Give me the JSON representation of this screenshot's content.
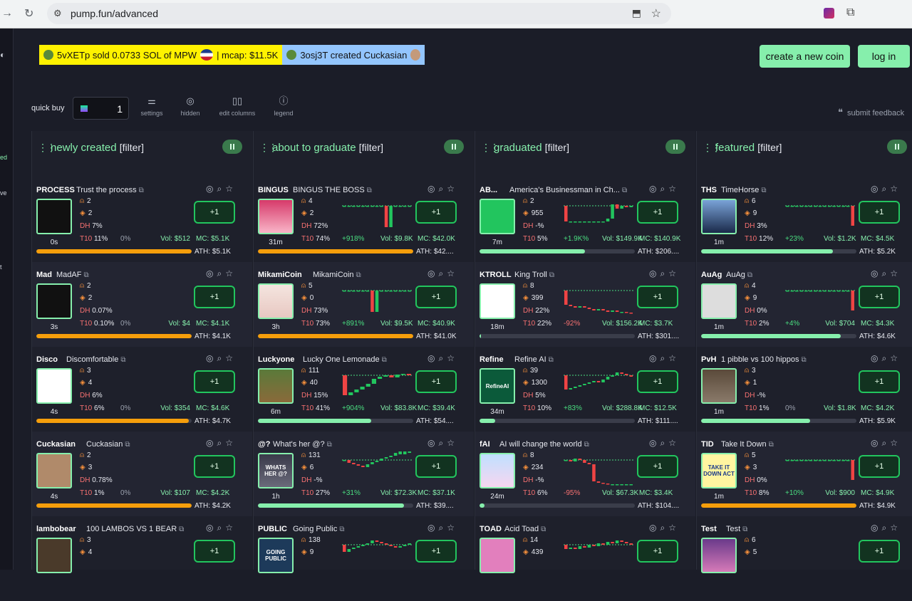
{
  "browser": {
    "url": "pump.fun/advanced"
  },
  "sidebar": {
    "items": [
      "ed",
      "ve",
      "t"
    ]
  },
  "ticker": {
    "item1": "5vXETp sold 0.0733 SOL of MPW",
    "item1_mcap": "| mcap: $11.5K",
    "item2": "3osj3T created Cuckasian"
  },
  "header": {
    "create_label": "create a new coin",
    "login_label": "log in"
  },
  "toolbar": {
    "quick_buy_label": "quick buy",
    "quick_buy_value": "1",
    "settings": "settings",
    "hidden": "hidden",
    "edit_columns": "edit columns",
    "legend": "legend",
    "feedback": "submit feedback"
  },
  "colors": {
    "accent": "#86efac",
    "bar_orange": "#f59e0b",
    "bar_green": "#86efac",
    "up": "#4ade80",
    "down": "#f87171"
  },
  "columns": [
    {
      "title": "newly created",
      "filter": "[filter]",
      "cards": [
        {
          "sym": "PROCESS",
          "name": "Trust the process",
          "holders": "2",
          "txs": "2",
          "dh": "7%",
          "t10": "11%",
          "chg": "0%",
          "vol": "$512",
          "mc": "$5.1K",
          "ath": "ATH: $5.1K",
          "age": "0s",
          "bar": 1.0,
          "color": "orange",
          "pic": "black",
          "spark": null
        },
        {
          "sym": "Mad",
          "name": "MadAF",
          "holders": "2",
          "txs": "2",
          "dh": "0.07%",
          "t10": "0.10%",
          "chg": "0%",
          "vol": "$4",
          "mc": "$4.1K",
          "ath": "ATH: $4.1K",
          "age": "3s",
          "bar": 1.0,
          "color": "orange",
          "pic": "black",
          "spark": null
        },
        {
          "sym": "Disco",
          "name": "Discomfortable",
          "holders": "3",
          "txs": "4",
          "dh": "6%",
          "t10": "6%",
          "chg": "0%",
          "vol": "$354",
          "mc": "$4.6K",
          "ath": "ATH: $4.7K",
          "age": "4s",
          "bar": 0.98,
          "color": "orange",
          "pic": "disco",
          "spark": null
        },
        {
          "sym": "Cuckasian",
          "name": "Cuckasian",
          "holders": "2",
          "txs": "3",
          "dh": "0.78%",
          "t10": "1%",
          "chg": "0%",
          "vol": "$107",
          "mc": "$4.2K",
          "ath": "ATH: $4.2K",
          "age": "4s",
          "bar": 1.0,
          "color": "orange",
          "pic": "face",
          "spark": null
        },
        {
          "sym": "lambobear",
          "name": "100 LAMBOS VS 1 BEAR",
          "holders": "3",
          "txs": "4",
          "dh": "",
          "t10": "",
          "chg": "",
          "vol": "",
          "mc": "",
          "ath": "",
          "age": "",
          "bar": 0,
          "color": "orange",
          "pic": "lambo",
          "spark": null
        }
      ]
    },
    {
      "title": "about to graduate",
      "filter": "[filter]",
      "cards": [
        {
          "sym": "BINGUS",
          "name": "BINGUS THE BOSS",
          "holders": "4",
          "txs": "2",
          "dh": "72%",
          "t10": "74%",
          "chg": "+918%",
          "vol": "$9.8K",
          "mc": "$42.0K",
          "ath": "ATH: $42....",
          "age": "31m",
          "bar": 1.0,
          "color": "orange",
          "pic": "pink",
          "spark": [
            0,
            0,
            0,
            0,
            0,
            0,
            0,
            0,
            0,
            -30,
            0,
            0,
            0,
            0,
            0
          ]
        },
        {
          "sym": "MikamiCoin",
          "name": "MikamiCoin",
          "holders": "5",
          "txs": "0",
          "dh": "73%",
          "t10": "73%",
          "chg": "+891%",
          "vol": "$9.5K",
          "mc": "$40.9K",
          "ath": "ATH: $41.0K",
          "age": "3h",
          "bar": 1.0,
          "color": "orange",
          "pic": "girl",
          "spark": [
            0,
            0,
            0,
            0,
            0,
            0,
            -30,
            0,
            0,
            0,
            0,
            0,
            0,
            0,
            0
          ]
        },
        {
          "sym": "Luckyone",
          "name": "Lucky One Lemonade",
          "holders": "111",
          "txs": "40",
          "dh": "15%",
          "t10": "41%",
          "chg": "+904%",
          "vol": "$83.8K",
          "mc": "$39.4K",
          "ath": "ATH: $54....",
          "age": "6m",
          "bar": 0.73,
          "color": "green",
          "pic": "dog",
          "spark": [
            -28,
            -24,
            -20,
            -16,
            -12,
            -5,
            -2,
            0,
            -3,
            1,
            2,
            0
          ]
        },
        {
          "sym": "@?",
          "name": "What's her @?",
          "holders": "131",
          "txs": "6",
          "dh": "-%",
          "t10": "27%",
          "chg": "+31%",
          "vol": "$72.3K",
          "mc": "$37.1K",
          "ath": "ATH: $39....",
          "age": "1h",
          "bar": 0.94,
          "color": "green",
          "pic": "whats",
          "spark": [
            0,
            -4,
            -6,
            -8,
            -10,
            -6,
            -3,
            -1,
            2,
            4,
            6,
            10,
            14,
            18,
            20
          ]
        },
        {
          "sym": "PUBLIC",
          "name": "Going Public",
          "holders": "138",
          "txs": "9",
          "dh": "",
          "t10": "",
          "chg": "",
          "vol": "",
          "mc": "",
          "ath": "",
          "age": "",
          "bar": 0,
          "color": "green",
          "pic": "public",
          "spark": [
            -10,
            -6,
            -4,
            -2,
            0,
            2,
            6,
            4,
            2,
            0,
            -2,
            -4,
            -2,
            0,
            2
          ]
        }
      ]
    },
    {
      "title": "graduated",
      "filter": "[filter]",
      "cards": [
        {
          "sym": "AB...",
          "name": "America's Businessman in Ch...",
          "holders": "2",
          "txs": "955",
          "dh": "-%",
          "t10": "5%",
          "chg": "+1.9K%",
          "vol": "$149.9K",
          "mc": "$140.9K",
          "ath": "ATH: $206....",
          "age": "7m",
          "bar": 0.68,
          "color": "green",
          "pic": "whale",
          "spark": [
            -22,
            -22,
            -22,
            -22,
            -22,
            -22,
            -22,
            -22,
            -22,
            -18,
            2,
            -4,
            0,
            -2,
            0
          ]
        },
        {
          "sym": "KTROLL",
          "name": "King Troll",
          "holders": "8",
          "txs": "399",
          "dh": "22%",
          "t10": "22%",
          "chg": "-92%",
          "vol": "$156.2K",
          "mc": "$3.7K",
          "ath": "ATH: $301....",
          "age": "18m",
          "bar": 0.01,
          "color": "green",
          "pic": "troll",
          "spark": [
            -20,
            -22,
            -24,
            -22,
            -24,
            -26,
            -28,
            -26,
            -28,
            -30,
            -28,
            -30,
            -30,
            -31,
            -32
          ]
        },
        {
          "sym": "Refine",
          "name": "Refine AI",
          "holders": "39",
          "txs": "1300",
          "dh": "5%",
          "t10": "10%",
          "chg": "+83%",
          "vol": "$288.8K",
          "mc": "$12.5K",
          "ath": "ATH: $111....",
          "age": "34m",
          "bar": 0.1,
          "color": "green",
          "pic": "refine",
          "spark": [
            -20,
            -18,
            -16,
            -14,
            -12,
            -10,
            -8,
            -10,
            -6,
            -2,
            0,
            4,
            2,
            0,
            -2
          ]
        },
        {
          "sym": "fAI",
          "name": "AI will change the world",
          "holders": "8",
          "txs": "234",
          "dh": "-%",
          "t10": "6%",
          "chg": "-95%",
          "vol": "$67.3K",
          "mc": "$3.4K",
          "ath": "ATH: $104....",
          "age": "24m",
          "bar": 0.03,
          "color": "green",
          "pic": "ai",
          "spark": [
            0,
            -2,
            2,
            0,
            -4,
            -6,
            -30,
            -32,
            -33,
            -34,
            -34,
            -34,
            -34,
            -34,
            -34
          ]
        },
        {
          "sym": "TOAD",
          "name": "Acid Toad",
          "holders": "14",
          "txs": "439",
          "dh": "",
          "t10": "",
          "chg": "",
          "vol": "",
          "mc": "",
          "ath": "",
          "age": "",
          "bar": 0,
          "color": "green",
          "pic": "toad",
          "spark": [
            -6,
            -4,
            -6,
            -2,
            -4,
            0,
            -2,
            2,
            0,
            4,
            2,
            6,
            4,
            2,
            0
          ]
        }
      ]
    },
    {
      "title": "featured",
      "filter": "[filter]",
      "cards": [
        {
          "sym": "THS",
          "name": "TimeHorse",
          "holders": "6",
          "txs": "9",
          "dh": "3%",
          "t10": "12%",
          "chg": "+23%",
          "vol": "$1.2K",
          "mc": "$4.5K",
          "ath": "ATH: $5.2K",
          "age": "1m",
          "bar": 0.85,
          "color": "green",
          "pic": "horse",
          "spark": [
            0,
            0,
            0,
            0,
            0,
            0,
            0,
            0,
            0,
            0,
            0,
            0,
            0,
            0,
            -28
          ]
        },
        {
          "sym": "AuAg",
          "name": "AuAg",
          "holders": "4",
          "txs": "9",
          "dh": "0%",
          "t10": "2%",
          "chg": "+4%",
          "vol": "$704",
          "mc": "$4.3K",
          "ath": "ATH: $4.6K",
          "age": "1m",
          "bar": 0.9,
          "color": "green",
          "pic": "sketch",
          "spark": [
            0,
            0,
            0,
            0,
            0,
            0,
            0,
            0,
            0,
            0,
            0,
            0,
            0,
            0,
            -28
          ]
        },
        {
          "sym": "PvH",
          "name": "1 pibble vs 100 hippos",
          "holders": "3",
          "txs": "1",
          "dh": "-%",
          "t10": "1%",
          "chg": "0%",
          "vol": "$1.8K",
          "mc": "$4.2K",
          "ath": "ATH: $5.9K",
          "age": "1m",
          "bar": 0.7,
          "color": "green",
          "pic": "hippo",
          "spark": null
        },
        {
          "sym": "TID",
          "name": "Take It Down",
          "holders": "5",
          "txs": "3",
          "dh": "0%",
          "t10": "8%",
          "chg": "+10%",
          "vol": "$900",
          "mc": "$4.9K",
          "ath": "ATH: $4.9K",
          "age": "1m",
          "bar": 1.0,
          "color": "orange",
          "pic": "take",
          "spark": [
            0,
            0,
            0,
            0,
            0,
            0,
            0,
            0,
            0,
            0,
            0,
            0,
            0,
            0,
            -28
          ]
        },
        {
          "sym": "Test",
          "name": "Test",
          "holders": "6",
          "txs": "5",
          "dh": "",
          "t10": "",
          "chg": "",
          "vol": "",
          "mc": "",
          "ath": "",
          "age": "",
          "bar": 0,
          "color": "green",
          "pic": "test",
          "spark": null
        }
      ]
    }
  ],
  "labels": {
    "dh": "DH",
    "t10": "T10",
    "vol": "Vol: ",
    "mc": "MC: ",
    "buy": "+1",
    "pic_whats": "WHATS HER @?",
    "pic_public": "GOING PUBLIC",
    "pic_refine": "RefineAI",
    "pic_take": "TAKE IT DOWN ACT"
  }
}
